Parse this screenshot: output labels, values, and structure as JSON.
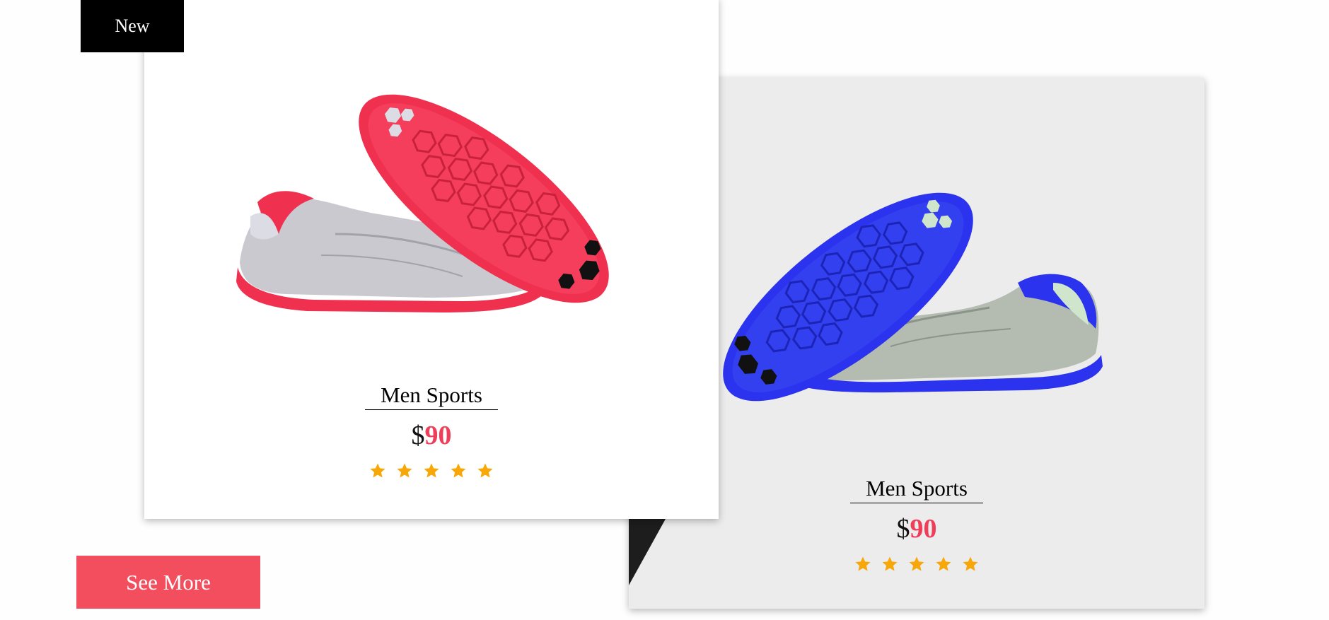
{
  "badge": {
    "label": "New"
  },
  "cards": [
    {
      "name": "Men Sports",
      "currency": "$",
      "price": "90",
      "rating": 5,
      "colors": {
        "accent": "#f0304f",
        "upper": "#c9c9cf",
        "background": "#ffffff"
      }
    },
    {
      "name": "Men Sports",
      "currency": "$",
      "price": "90",
      "rating": 5,
      "colors": {
        "accent": "#2b33ee",
        "upper": "#b4bcb2",
        "background": "#ececec"
      }
    }
  ],
  "actions": {
    "see_more_label": "See More"
  },
  "colors": {
    "price_accent": "#ef3e5a",
    "star": "#f7a707",
    "button_bg": "#f24e5e",
    "badge_bg": "#000000"
  }
}
